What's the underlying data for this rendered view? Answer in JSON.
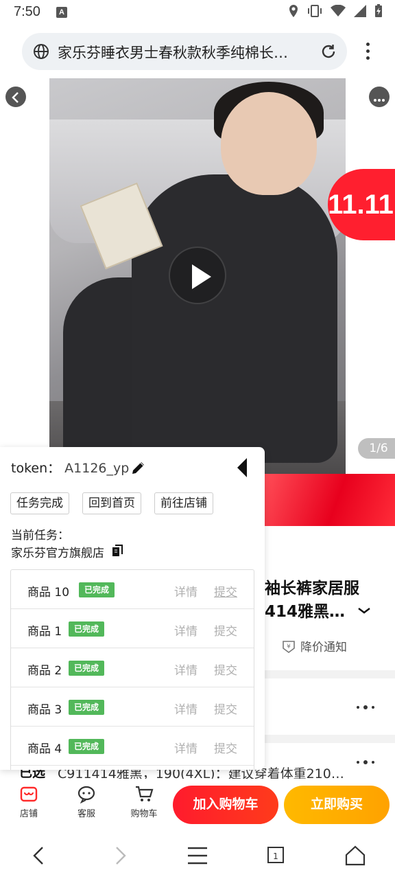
{
  "status_bar": {
    "time": "7:50"
  },
  "browser": {
    "page_title": "家乐芬睡衣男士春秋款秋季纯棉长…"
  },
  "product": {
    "badge": "11.11",
    "pager": "1/6",
    "title_fragment": [
      "袖长裤家居服",
      "414雅黑…"
    ],
    "price_alert": "降价通知",
    "selected_label": "已选",
    "selected_value": "C911414雅黑，190(4XL)：建议穿着体重210…"
  },
  "panel": {
    "token_label": "token：",
    "token_value": "A1126_yp",
    "buttons": [
      "任务完成",
      "回到首页",
      "前往店铺"
    ],
    "task_label": "当前任务：",
    "shop_name": "家乐芬官方旗舰店",
    "items": [
      {
        "name": "商品 10",
        "status": "已完成",
        "detail": "详情",
        "submit": "提交"
      },
      {
        "name": "商品 1",
        "status": "已完成",
        "detail": "详情",
        "submit": "提交"
      },
      {
        "name": "商品 2",
        "status": "已完成",
        "detail": "详情",
        "submit": "提交"
      },
      {
        "name": "商品 3",
        "status": "已完成",
        "detail": "详情",
        "submit": "提交"
      },
      {
        "name": "商品 4",
        "status": "已完成",
        "detail": "详情",
        "submit": "提交"
      }
    ]
  },
  "bottom_bar": {
    "shop": "店铺",
    "service": "客服",
    "cart": "购物车",
    "add_to_cart": "加入购物车",
    "buy_now": "立即购买"
  },
  "colors": {
    "red": "#ff1b2d",
    "yellow": "#ffb900",
    "done_green": "#52b85a"
  }
}
